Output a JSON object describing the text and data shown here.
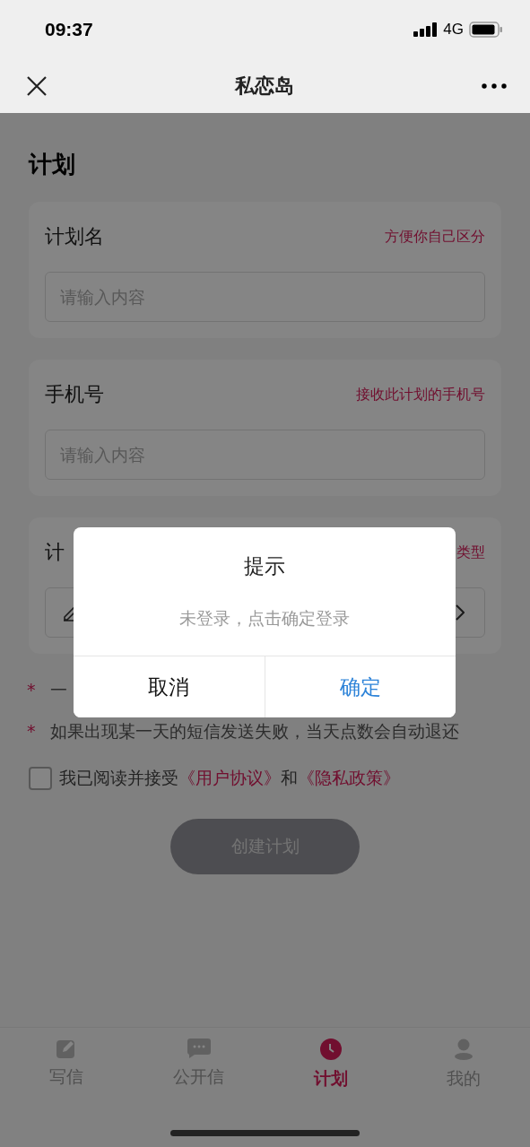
{
  "status_bar": {
    "time": "09:37",
    "network": "4G"
  },
  "navbar": {
    "title": "私恋岛"
  },
  "page_title": "计划",
  "cards": [
    {
      "kind": "input",
      "label": "计划名",
      "hint": "方便你自己区分",
      "placeholder": "请输入内容"
    },
    {
      "kind": "input",
      "label": "手机号",
      "hint": "接收此计划的手机号",
      "placeholder": "请输入内容"
    },
    {
      "kind": "picker",
      "label": "计",
      "hint": "类型"
    }
  ],
  "notes": [
    {
      "mark": "*",
      "text": "一"
    },
    {
      "mark": "*",
      "text": "如果出现某一天的短信发送失败，当天点数会自动退还"
    }
  ],
  "agreement": {
    "checked": false,
    "text": "我已阅读并接受",
    "link_1": "《用户协议》",
    "joiner": "和",
    "link_2": "《隐私政策》"
  },
  "submit": {
    "label": "创建计划",
    "disabled": true
  },
  "tabs": [
    {
      "label": "写信",
      "selected": false
    },
    {
      "label": "公开信",
      "selected": false
    },
    {
      "label": "计划",
      "selected": true
    },
    {
      "label": "我的",
      "selected": false
    }
  ],
  "dialog": {
    "title": "提示",
    "message": "未登录，点击确定登录",
    "buttons": [
      {
        "kind": "cancel",
        "label": "取消"
      },
      {
        "kind": "confirm",
        "label": "确定"
      }
    ]
  }
}
